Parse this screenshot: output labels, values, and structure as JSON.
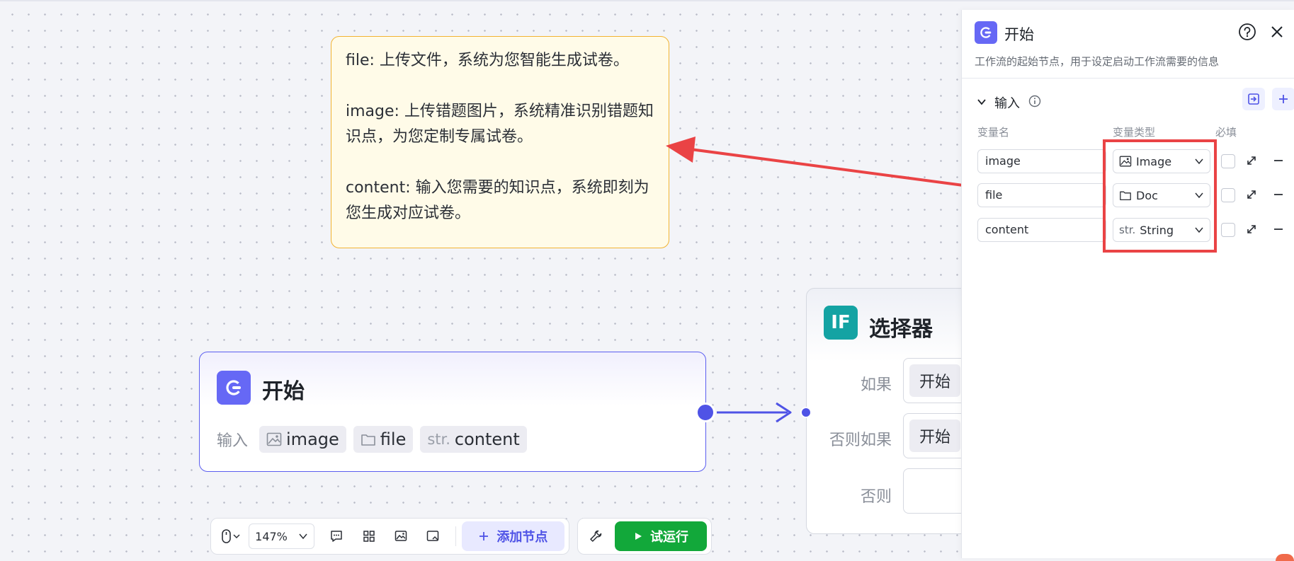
{
  "note": {
    "lines": [
      "file: 上传文件，系统为您智能生成试卷。",
      "image: 上传错题图片，系统精准识别错题知识点，为您定制专属试卷。",
      "content: 输入您需要的知识点，系统即刻为您生成对应试卷。"
    ]
  },
  "start_node": {
    "title": "开始",
    "inputs_label": "输入",
    "inputs": [
      {
        "label": "image",
        "icon": "image-icon"
      },
      {
        "label": "file",
        "icon": "folder-icon"
      },
      {
        "prefix": "str.",
        "label": "content"
      }
    ]
  },
  "selector_node": {
    "icon_text": "IF",
    "title": "选择器",
    "conditions": [
      {
        "label": "如果",
        "value": "开始"
      },
      {
        "label": "否则如果",
        "value": "开始"
      },
      {
        "label": "否则",
        "value": ""
      }
    ]
  },
  "panel": {
    "title": "开始",
    "description": "工作流的起始节点，用于设定启动工作流需要的信息",
    "section_title": "输入",
    "columns": {
      "name": "变量名",
      "type": "变量类型",
      "required": "必填"
    },
    "variables": [
      {
        "name": "image",
        "type": "Image",
        "type_icon": "image-icon"
      },
      {
        "name": "file",
        "type": "Doc",
        "type_icon": "folder-icon"
      },
      {
        "name": "content",
        "type": "String",
        "type_prefix": "str."
      }
    ]
  },
  "toolbar": {
    "zoom": "147%",
    "add_node": "添加节点",
    "test_run": "试运行"
  },
  "colors": {
    "accent": "#5b5ef0",
    "run": "#12a83a",
    "highlight": "#ea4345",
    "note_border": "#f2b331",
    "selector_icon": "#14a3a3"
  }
}
